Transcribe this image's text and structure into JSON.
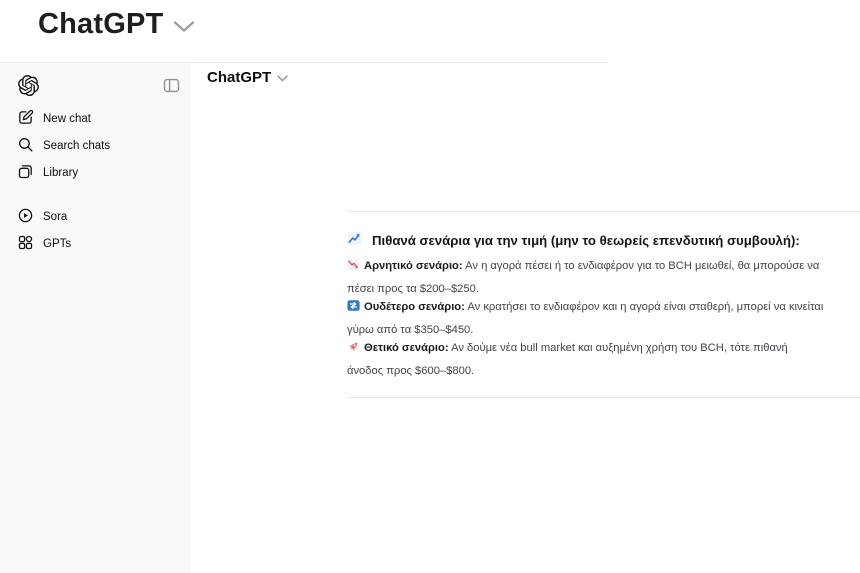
{
  "overlay": {
    "title": "ChatGPT"
  },
  "sidebar": {
    "items": [
      {
        "label": "New chat",
        "icon": "new-chat-icon"
      },
      {
        "label": "Search chats",
        "icon": "search-icon"
      },
      {
        "label": "Library",
        "icon": "library-icon"
      },
      {
        "label": "Sora",
        "icon": "sora-icon"
      },
      {
        "label": "GPTs",
        "icon": "gpts-icon"
      }
    ]
  },
  "header": {
    "model_name": "ChatGPT"
  },
  "message": {
    "heading": {
      "icon": "chart-increasing-emoji",
      "text": "Πιθανά σενάρια για την τιμή (μην το θεωρείς επενδυτική συμβουλή):"
    },
    "scenarios": [
      {
        "icon": "chart-decreasing-emoji",
        "label": "Αρνητικό σενάριο:",
        "text": " Αν η αγορά πέσει ή το ενδιαφέρον για το BCH μειωθεί, θα μπορούσε να πέσει προς τα $200–$250."
      },
      {
        "icon": "repeat-emoji",
        "label": "Ουδέτερο σενάριο:",
        "text": " Αν κρατήσει το ενδιαφέρον και η αγορά είναι σταθερή, μπορεί να κινείται γύρω από τα $350–$450."
      },
      {
        "icon": "rocket-emoji",
        "label": "Θετικό σενάριο:",
        "text": " Αν δούμε νέα bull market και αυξημένη χρήση του BCH, τότε πιθανή άνοδος προς $600–$800."
      }
    ]
  },
  "colors": {
    "sidebar_bg": "#f9f9f9",
    "divider": "#e7e7e7",
    "text_primary": "#0d0d0d",
    "text_body": "#43434b",
    "emoji_blue": "#3c7dd9",
    "emoji_red": "#d85a6a",
    "emoji_repeat_blue": "#3178c6",
    "emoji_rocket_pink": "#e56a78"
  }
}
